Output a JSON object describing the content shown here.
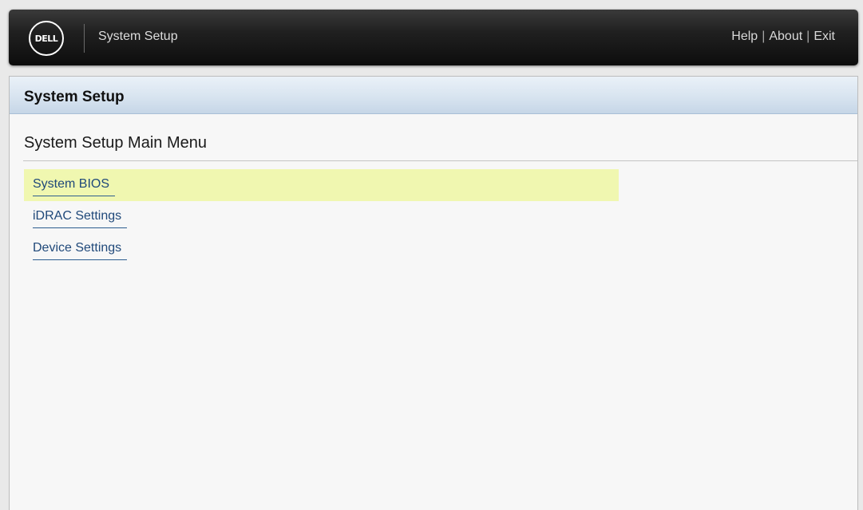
{
  "header": {
    "logo_text": "DELL",
    "app_title": "System Setup",
    "links": [
      {
        "label": "Help"
      },
      {
        "label": "About"
      },
      {
        "label": "Exit"
      }
    ],
    "separator": "|"
  },
  "panel": {
    "title": "System Setup",
    "heading": "System Setup Main Menu"
  },
  "menu": {
    "selected_index": 0,
    "items": [
      {
        "label": "System BIOS"
      },
      {
        "label": "iDRAC Settings"
      },
      {
        "label": "Device Settings"
      }
    ]
  },
  "colors": {
    "highlight": "#f0f7b0",
    "link": "#20497a",
    "header_bar": "#1a1a1a"
  }
}
